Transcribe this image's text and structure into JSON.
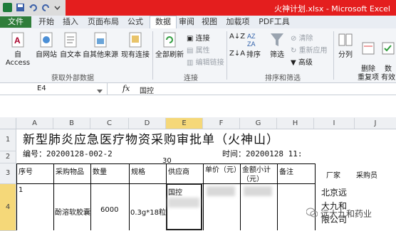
{
  "window": {
    "title": "火神计划.xlsx - Microsoft Excel"
  },
  "tabs": {
    "file": "文件",
    "home": "开始",
    "insert": "插入",
    "page_layout": "页面布局",
    "formulas": "公式",
    "data": "数据",
    "review": "审阅",
    "view": "视图",
    "addins": "加载项",
    "pdf": "PDF工具"
  },
  "ribbon": {
    "from_access": "自 Access",
    "from_web": "自网站",
    "from_text": "自文本",
    "from_other": "自其他来源",
    "existing": "现有连接",
    "refresh_all": "全部刷新",
    "connections": "连接",
    "properties": "属性",
    "edit_links": "编辑链接",
    "sort": "排序",
    "filter": "筛选",
    "clear": "清除",
    "reapply": "重新应用",
    "advanced": "高级",
    "split": "分列",
    "remove_dup": "删除\n重复项",
    "validation": "数\n有效",
    "group_external": "获取外部数据",
    "group_connections": "连接",
    "group_sort": "排序和筛选"
  },
  "formula_bar": {
    "name_box": "E4",
    "fx": "fx",
    "content": "国控"
  },
  "columns": [
    "A",
    "B",
    "C",
    "D",
    "E",
    "F",
    "G",
    "H",
    "I",
    "J"
  ],
  "rows": [
    "1",
    "2",
    "3",
    "4"
  ],
  "sheet": {
    "title": "新型肺炎应急医疗物资采购审批单（火神山）",
    "number": "编号：20200128-002-2",
    "time": "时间：20200128 11:",
    "time_tail": "30",
    "headers": [
      "序号",
      "采购物品",
      "数量",
      "规格",
      "供应商",
      "单价（元）",
      "金额小计（元）",
      "备注"
    ],
    "extra_headers": [
      "厂家",
      "采购员"
    ],
    "row4": {
      "seq": "1",
      "item": "酚溶软胶囊",
      "qty": "6000",
      "spec": "0.3g*18粒",
      "supplier": "国控",
      "maker": [
        "北京远",
        "大九和",
        "限公司"
      ]
    }
  },
  "watermark": "远大九和药业"
}
